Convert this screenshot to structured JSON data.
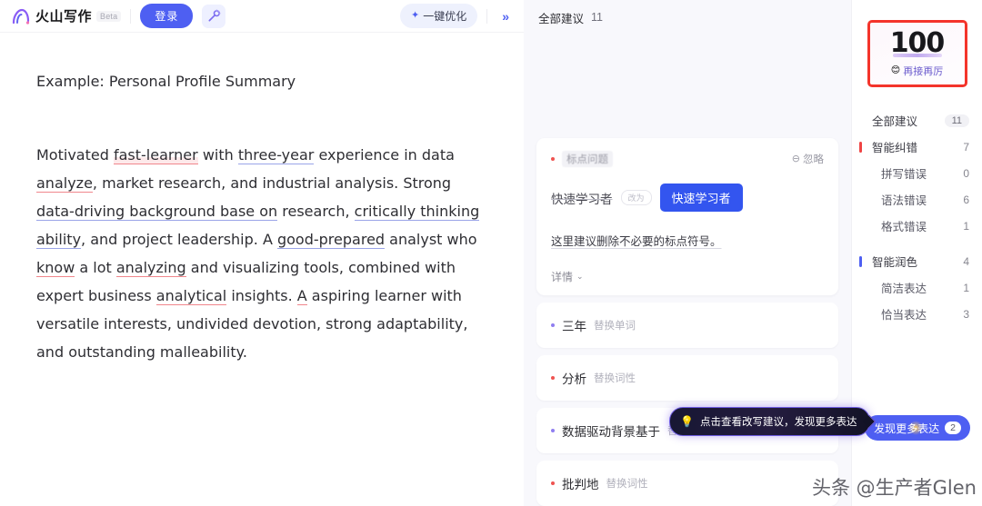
{
  "topbar": {
    "brand_name": "火山写作",
    "beta_tag": "Beta",
    "login_label": "登录",
    "magic_icon": "magic-wand-icon",
    "optimize_label": "一键优化",
    "spark_glyph": "✦",
    "collapse_glyph": "»"
  },
  "document": {
    "title": "Example: Personal Profile Summary",
    "paragraph_parts": {
      "p1": "Motivated ",
      "e1": "fast-learner",
      "p2": " with ",
      "e2": "three-year",
      "p3": " experience in data ",
      "e3": "analyze",
      "p4": ", market research, and industrial analysis. Strong ",
      "e4": "data-driving background base on",
      "p5": " research, ",
      "e5": "critically thinking ability",
      "p6": ", and project leadership. A ",
      "e6": "good-prepared",
      "p7": " analyst who ",
      "e7": "know",
      "p8": " a lot ",
      "e8": "analyzing",
      "p9": " and visualizing tools, combined with expert business ",
      "e9": "analytical",
      "p10": " insights. ",
      "e10": "A",
      "p11": " aspiring learner with versatile interests, undivided devotion, strong adaptability, and outstanding malleability."
    }
  },
  "suggestion_panel": {
    "header_title": "全部建议",
    "header_count": "11",
    "active_card": {
      "tag": "标点问题",
      "ignore_label": "忽略",
      "ignore_icon": "minus-circle-icon",
      "original_text": "快速学习者",
      "arrow_glyph": "改为",
      "replacement_text": "快速学习者",
      "description": "这里建议删除不必要的标点符号。",
      "detail_label": "详情",
      "detail_chevron": "⌄"
    },
    "items": [
      {
        "word": "三年",
        "type": "替换单词",
        "dot": "purple"
      },
      {
        "word": "分析",
        "type": "替换词性",
        "dot": "pink"
      },
      {
        "word": "数据驱动背景基于",
        "type": "替换词性",
        "dot": "purple"
      },
      {
        "word": "批判地",
        "type": "替换词性",
        "dot": "pink"
      }
    ]
  },
  "tooltip": {
    "icon": "lightbulb-icon",
    "emoji": "💡",
    "text": "点击查看改写建议，发现更多表达"
  },
  "sidebar": {
    "score": {
      "value": "100",
      "emoji": "😊",
      "label": "再接再厉",
      "border_color": "#f4342b"
    },
    "all_suggestions": {
      "label": "全部建议",
      "count": "11"
    },
    "groups": [
      {
        "label": "智能纠错",
        "count": "7",
        "bar_color": "#ef4444",
        "children": [
          {
            "label": "拼写错误",
            "count": "0"
          },
          {
            "label": "语法错误",
            "count": "6"
          },
          {
            "label": "格式错误",
            "count": "1"
          }
        ]
      },
      {
        "label": "智能润色",
        "count": "4",
        "bar_color": "#4e5ff2",
        "children": [
          {
            "label": "简洁表达",
            "count": "1"
          },
          {
            "label": "恰当表达",
            "count": "3"
          }
        ]
      }
    ],
    "discover_button": {
      "label": "发现更多表达",
      "count": "2"
    }
  },
  "watermark": {
    "text": "头条 @生产者Glen"
  }
}
